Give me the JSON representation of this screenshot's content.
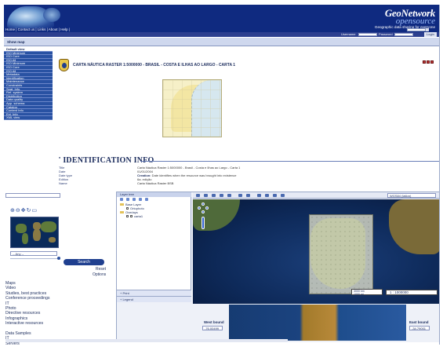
{
  "header": {
    "top_links": "Home | Contact us | Links | About | Help |",
    "brand_name": "GeoNetwork",
    "brand_sub": "opensource",
    "tagline": "Geographic data sharing for everyone",
    "username_label": "Username",
    "password_label": "Password",
    "login_label": "Login"
  },
  "show_map": "Show map",
  "sidebar": {
    "items": [
      {
        "label": "Default view",
        "top": true
      },
      {
        "label": "ISO Minimum",
        "top": false
      },
      {
        "label": "ISO Core",
        "top": false
      },
      {
        "label": "ISO All",
        "top": false
      },
      {
        "label": "ISO Minimum",
        "top": false
      },
      {
        "label": "ISO Core",
        "top": false
      },
      {
        "label": "ISO All",
        "top": false
      },
      {
        "label": "Metadata",
        "top": false
      },
      {
        "label": "Identification",
        "top": false
      },
      {
        "label": "Maintenance",
        "top": false
      },
      {
        "label": "Constraints",
        "top": false
      },
      {
        "label": "Spat. Info.",
        "top": false
      },
      {
        "label": "Ref. system",
        "top": false
      },
      {
        "label": "Distribution",
        "top": false
      },
      {
        "label": "Data quality",
        "top": false
      },
      {
        "label": "App. schema",
        "top": false
      },
      {
        "label": "Catalog",
        "top": false
      },
      {
        "label": "Content Info",
        "top": false
      },
      {
        "label": "Ext. Info",
        "top": false
      },
      {
        "label": "XML view",
        "top": false
      }
    ]
  },
  "metadata": {
    "title": "CARTA NÁUTICA RASTER 1:5000000 - BRASIL - COSTA E ILHAS AO LARGO - CARTA 1",
    "section_title": "IDENTIFICATION INFO",
    "rows": [
      {
        "key": "Title",
        "value": "Carta Náutica Raster 1:5000000 - Brasil - Costa e Ilhas ao Largo - Carta 1"
      },
      {
        "key": "Date",
        "value": "01/01/2004"
      },
      {
        "key": "Date type",
        "value": "Creation: Date identifies when the resource was brought into existence"
      },
      {
        "key": "Edition",
        "value": "6a. edição"
      },
      {
        "key": "Name",
        "value": "Carta Náutica Raster BSB"
      }
    ]
  },
  "search_panel": {
    "any_value": "-- Any --",
    "search_label": "Search",
    "reset_label": "Reset",
    "options_label": "Options",
    "categories": [
      "Maps",
      "Video",
      "Studies, best practices",
      "Conference proceedings",
      "IT",
      "Photo",
      "Directive resources",
      "Infographics",
      "Interactive resources",
      "",
      "Data Samples",
      "IT",
      "Servers"
    ]
  },
  "map": {
    "layer_tree_label": "Layer tree",
    "base_layer_label": "Base Layer",
    "base_layer_item": "Ortophoto",
    "overlays_label": "Overlays",
    "overlay_item": "carta1",
    "print_label": "Print",
    "legend_label": "Legend",
    "projection": "WGS84 (latlon)",
    "scale_bar_top": "3000 km",
    "scale_bar_bottom": "1000 mi",
    "scale_value": "1 : 1000000",
    "west_bound_label": "West bound",
    "west_bound_value": "-76.00499",
    "east_bound_label": "East bound",
    "east_bound_value": "-34.79001"
  }
}
